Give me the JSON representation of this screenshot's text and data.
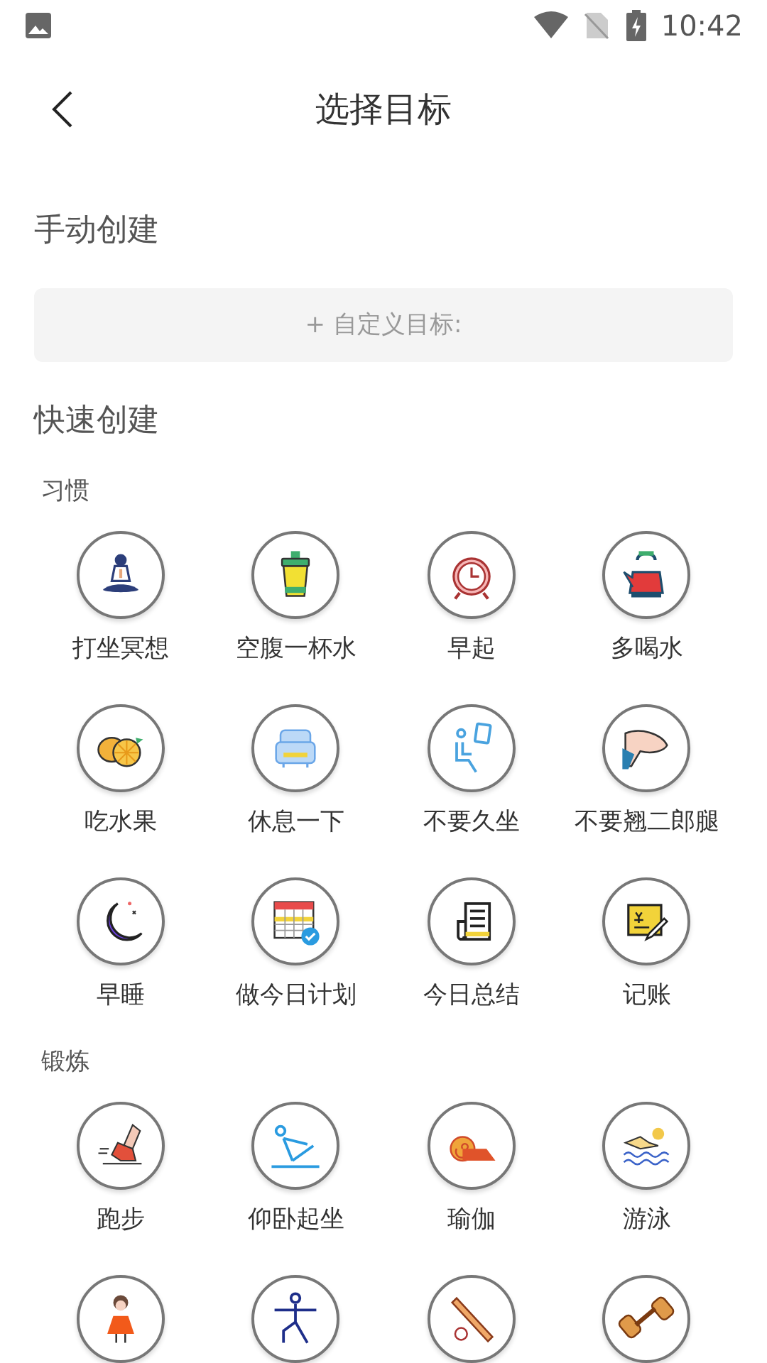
{
  "status_bar": {
    "time": "10:42"
  },
  "header": {
    "title": "选择目标"
  },
  "manual": {
    "heading": "手动创建",
    "field": {
      "placeholder": "+ 自定义目标:"
    }
  },
  "quick": {
    "heading": "快速创建",
    "sections": [
      {
        "title": "习惯",
        "items": [
          {
            "kind": "meditation",
            "label": "打坐冥想"
          },
          {
            "kind": "cup",
            "label": "空腹一杯水"
          },
          {
            "kind": "alarm",
            "label": "早起"
          },
          {
            "kind": "kettle",
            "label": "多喝水"
          },
          {
            "kind": "fruit",
            "label": "吃水果"
          },
          {
            "kind": "sofa",
            "label": "休息一下"
          },
          {
            "kind": "sitting",
            "label": "不要久坐"
          },
          {
            "kind": "legs",
            "label": "不要翘二郎腿"
          },
          {
            "kind": "moon",
            "label": "早睡"
          },
          {
            "kind": "calendar",
            "label": "做今日计划"
          },
          {
            "kind": "document",
            "label": "今日总结"
          },
          {
            "kind": "ledger",
            "label": "记账"
          }
        ]
      },
      {
        "title": "锻炼",
        "items": [
          {
            "kind": "running",
            "label": "跑步"
          },
          {
            "kind": "situp",
            "label": "仰卧起坐"
          },
          {
            "kind": "mat",
            "label": "瑜伽"
          },
          {
            "kind": "swim",
            "label": "游泳"
          },
          {
            "kind": "dancer"
          },
          {
            "kind": "stretch"
          },
          {
            "kind": "bat"
          },
          {
            "kind": "dumbbell"
          }
        ]
      }
    ]
  }
}
